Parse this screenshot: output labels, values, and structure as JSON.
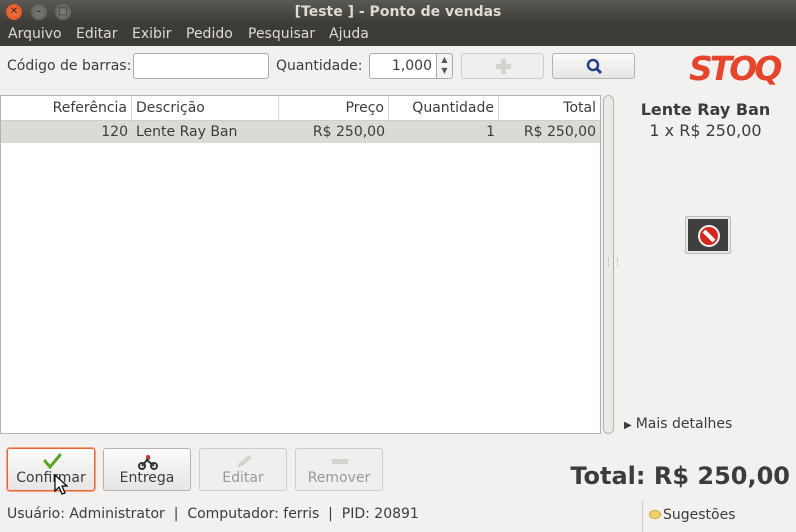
{
  "window": {
    "title": "[Teste ] - Ponto de vendas"
  },
  "menu": [
    "Arquivo",
    "Editar",
    "Exibir",
    "Pedido",
    "Pesquisar",
    "Ajuda"
  ],
  "toolbar": {
    "barcode_label": "Código de barras:",
    "barcode_value": "",
    "quantity_label": "Quantidade:",
    "quantity_value": "1,000",
    "add_icon": "plus-icon",
    "search_icon": "magnifier-icon"
  },
  "logo": "STOQ",
  "table": {
    "columns": [
      "Referência",
      "Descrição",
      "Preço",
      "Quantidade",
      "Total"
    ],
    "rows": [
      {
        "ref": "120",
        "desc": "Lente Ray Ban",
        "price": "R$ 250,00",
        "qty": "1",
        "total": "R$ 250,00"
      }
    ]
  },
  "product": {
    "name": "Lente Ray Ban",
    "qty_line": "1 x R$ 250,00",
    "image_icon": "no-image-icon"
  },
  "details_label": "Mais detalhes",
  "buttons": {
    "confirm": "Confirmar",
    "delivery": "Entrega",
    "edit": "Editar",
    "remove": "Remover"
  },
  "total": "Total: R$ 250,00",
  "statusbar": {
    "text": "Usuário: Administrator  |  Computador: ferris  |  PID: 20891",
    "suggestions": "Sugestões"
  },
  "colors": {
    "accent": "#e5452c",
    "selection": "#dcdad5"
  }
}
